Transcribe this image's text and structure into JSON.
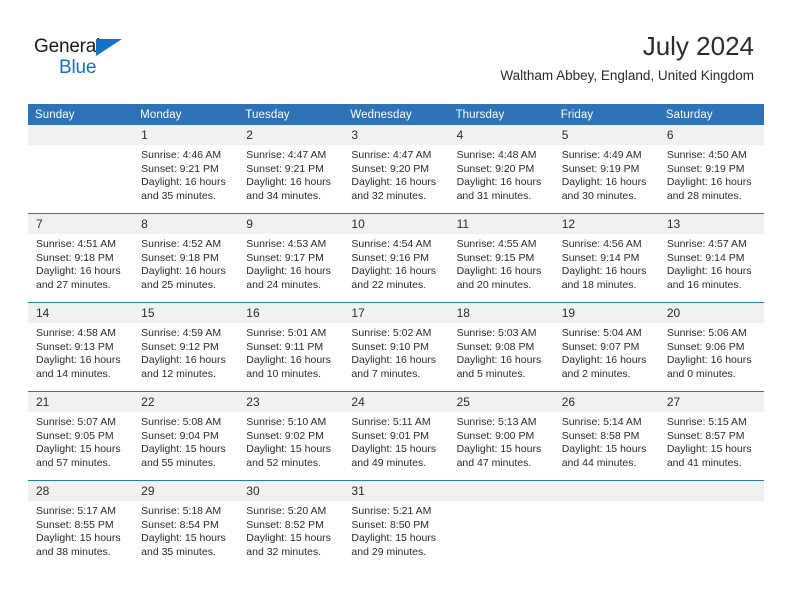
{
  "brand": {
    "name_part1": "General",
    "name_part2": "Blue",
    "accent_color": "#1273C4"
  },
  "header": {
    "title": "July 2024",
    "location": "Waltham Abbey, England, United Kingdom"
  },
  "theme": {
    "header_blue": "#2E72B8",
    "daynum_bg": "#f1f1f1",
    "text": "#2b2b2b"
  },
  "weekday_headers": [
    "Sunday",
    "Monday",
    "Tuesday",
    "Wednesday",
    "Thursday",
    "Friday",
    "Saturday"
  ],
  "weeks": [
    [
      {
        "day": "",
        "empty": true,
        "sunrise": "",
        "sunset": "",
        "daylight_line1": "",
        "daylight_line2": ""
      },
      {
        "day": "1",
        "sunrise": "Sunrise: 4:46 AM",
        "sunset": "Sunset: 9:21 PM",
        "daylight_line1": "Daylight: 16 hours",
        "daylight_line2": "and 35 minutes."
      },
      {
        "day": "2",
        "sunrise": "Sunrise: 4:47 AM",
        "sunset": "Sunset: 9:21 PM",
        "daylight_line1": "Daylight: 16 hours",
        "daylight_line2": "and 34 minutes."
      },
      {
        "day": "3",
        "sunrise": "Sunrise: 4:47 AM",
        "sunset": "Sunset: 9:20 PM",
        "daylight_line1": "Daylight: 16 hours",
        "daylight_line2": "and 32 minutes."
      },
      {
        "day": "4",
        "sunrise": "Sunrise: 4:48 AM",
        "sunset": "Sunset: 9:20 PM",
        "daylight_line1": "Daylight: 16 hours",
        "daylight_line2": "and 31 minutes."
      },
      {
        "day": "5",
        "sunrise": "Sunrise: 4:49 AM",
        "sunset": "Sunset: 9:19 PM",
        "daylight_line1": "Daylight: 16 hours",
        "daylight_line2": "and 30 minutes."
      },
      {
        "day": "6",
        "sunrise": "Sunrise: 4:50 AM",
        "sunset": "Sunset: 9:19 PM",
        "daylight_line1": "Daylight: 16 hours",
        "daylight_line2": "and 28 minutes."
      }
    ],
    [
      {
        "day": "7",
        "sunrise": "Sunrise: 4:51 AM",
        "sunset": "Sunset: 9:18 PM",
        "daylight_line1": "Daylight: 16 hours",
        "daylight_line2": "and 27 minutes."
      },
      {
        "day": "8",
        "sunrise": "Sunrise: 4:52 AM",
        "sunset": "Sunset: 9:18 PM",
        "daylight_line1": "Daylight: 16 hours",
        "daylight_line2": "and 25 minutes."
      },
      {
        "day": "9",
        "sunrise": "Sunrise: 4:53 AM",
        "sunset": "Sunset: 9:17 PM",
        "daylight_line1": "Daylight: 16 hours",
        "daylight_line2": "and 24 minutes."
      },
      {
        "day": "10",
        "sunrise": "Sunrise: 4:54 AM",
        "sunset": "Sunset: 9:16 PM",
        "daylight_line1": "Daylight: 16 hours",
        "daylight_line2": "and 22 minutes."
      },
      {
        "day": "11",
        "sunrise": "Sunrise: 4:55 AM",
        "sunset": "Sunset: 9:15 PM",
        "daylight_line1": "Daylight: 16 hours",
        "daylight_line2": "and 20 minutes."
      },
      {
        "day": "12",
        "sunrise": "Sunrise: 4:56 AM",
        "sunset": "Sunset: 9:14 PM",
        "daylight_line1": "Daylight: 16 hours",
        "daylight_line2": "and 18 minutes."
      },
      {
        "day": "13",
        "sunrise": "Sunrise: 4:57 AM",
        "sunset": "Sunset: 9:14 PM",
        "daylight_line1": "Daylight: 16 hours",
        "daylight_line2": "and 16 minutes."
      }
    ],
    [
      {
        "day": "14",
        "sunrise": "Sunrise: 4:58 AM",
        "sunset": "Sunset: 9:13 PM",
        "daylight_line1": "Daylight: 16 hours",
        "daylight_line2": "and 14 minutes."
      },
      {
        "day": "15",
        "sunrise": "Sunrise: 4:59 AM",
        "sunset": "Sunset: 9:12 PM",
        "daylight_line1": "Daylight: 16 hours",
        "daylight_line2": "and 12 minutes."
      },
      {
        "day": "16",
        "sunrise": "Sunrise: 5:01 AM",
        "sunset": "Sunset: 9:11 PM",
        "daylight_line1": "Daylight: 16 hours",
        "daylight_line2": "and 10 minutes."
      },
      {
        "day": "17",
        "sunrise": "Sunrise: 5:02 AM",
        "sunset": "Sunset: 9:10 PM",
        "daylight_line1": "Daylight: 16 hours",
        "daylight_line2": "and 7 minutes."
      },
      {
        "day": "18",
        "sunrise": "Sunrise: 5:03 AM",
        "sunset": "Sunset: 9:08 PM",
        "daylight_line1": "Daylight: 16 hours",
        "daylight_line2": "and 5 minutes."
      },
      {
        "day": "19",
        "sunrise": "Sunrise: 5:04 AM",
        "sunset": "Sunset: 9:07 PM",
        "daylight_line1": "Daylight: 16 hours",
        "daylight_line2": "and 2 minutes."
      },
      {
        "day": "20",
        "sunrise": "Sunrise: 5:06 AM",
        "sunset": "Sunset: 9:06 PM",
        "daylight_line1": "Daylight: 16 hours",
        "daylight_line2": "and 0 minutes."
      }
    ],
    [
      {
        "day": "21",
        "sunrise": "Sunrise: 5:07 AM",
        "sunset": "Sunset: 9:05 PM",
        "daylight_line1": "Daylight: 15 hours",
        "daylight_line2": "and 57 minutes."
      },
      {
        "day": "22",
        "sunrise": "Sunrise: 5:08 AM",
        "sunset": "Sunset: 9:04 PM",
        "daylight_line1": "Daylight: 15 hours",
        "daylight_line2": "and 55 minutes."
      },
      {
        "day": "23",
        "sunrise": "Sunrise: 5:10 AM",
        "sunset": "Sunset: 9:02 PM",
        "daylight_line1": "Daylight: 15 hours",
        "daylight_line2": "and 52 minutes."
      },
      {
        "day": "24",
        "sunrise": "Sunrise: 5:11 AM",
        "sunset": "Sunset: 9:01 PM",
        "daylight_line1": "Daylight: 15 hours",
        "daylight_line2": "and 49 minutes."
      },
      {
        "day": "25",
        "sunrise": "Sunrise: 5:13 AM",
        "sunset": "Sunset: 9:00 PM",
        "daylight_line1": "Daylight: 15 hours",
        "daylight_line2": "and 47 minutes."
      },
      {
        "day": "26",
        "sunrise": "Sunrise: 5:14 AM",
        "sunset": "Sunset: 8:58 PM",
        "daylight_line1": "Daylight: 15 hours",
        "daylight_line2": "and 44 minutes."
      },
      {
        "day": "27",
        "sunrise": "Sunrise: 5:15 AM",
        "sunset": "Sunset: 8:57 PM",
        "daylight_line1": "Daylight: 15 hours",
        "daylight_line2": "and 41 minutes."
      }
    ],
    [
      {
        "day": "28",
        "sunrise": "Sunrise: 5:17 AM",
        "sunset": "Sunset: 8:55 PM",
        "daylight_line1": "Daylight: 15 hours",
        "daylight_line2": "and 38 minutes."
      },
      {
        "day": "29",
        "sunrise": "Sunrise: 5:18 AM",
        "sunset": "Sunset: 8:54 PM",
        "daylight_line1": "Daylight: 15 hours",
        "daylight_line2": "and 35 minutes."
      },
      {
        "day": "30",
        "sunrise": "Sunrise: 5:20 AM",
        "sunset": "Sunset: 8:52 PM",
        "daylight_line1": "Daylight: 15 hours",
        "daylight_line2": "and 32 minutes."
      },
      {
        "day": "31",
        "sunrise": "Sunrise: 5:21 AM",
        "sunset": "Sunset: 8:50 PM",
        "daylight_line1": "Daylight: 15 hours",
        "daylight_line2": "and 29 minutes."
      },
      {
        "day": "",
        "empty": true,
        "sunrise": "",
        "sunset": "",
        "daylight_line1": "",
        "daylight_line2": ""
      },
      {
        "day": "",
        "empty": true,
        "sunrise": "",
        "sunset": "",
        "daylight_line1": "",
        "daylight_line2": ""
      },
      {
        "day": "",
        "empty": true,
        "sunrise": "",
        "sunset": "",
        "daylight_line1": "",
        "daylight_line2": ""
      }
    ]
  ]
}
